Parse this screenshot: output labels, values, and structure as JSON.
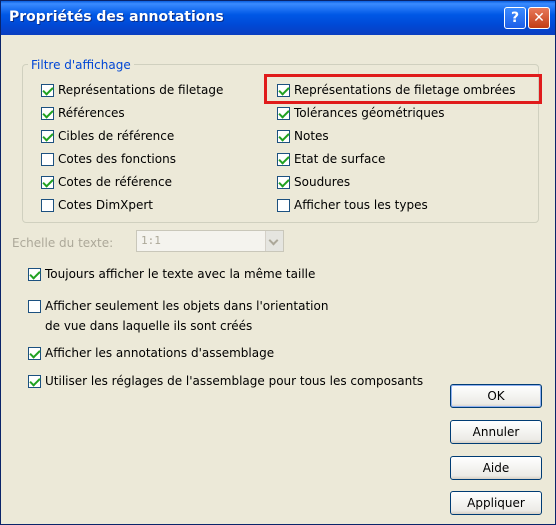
{
  "window": {
    "title": "Propriétés des annotations",
    "help_glyph": "?",
    "close_glyph": "✕"
  },
  "filter": {
    "legend": "Filtre d'affichage",
    "left": [
      {
        "label": "Représentations de filetage",
        "checked": true
      },
      {
        "label": "Références",
        "checked": true
      },
      {
        "label": "Cibles de référence",
        "checked": true
      },
      {
        "label": "Cotes des fonctions",
        "checked": false
      },
      {
        "label": "Cotes de référence",
        "checked": true
      },
      {
        "label": "Cotes DimXpert",
        "checked": false
      }
    ],
    "right": [
      {
        "label": "Représentations de filetage ombrées",
        "checked": true
      },
      {
        "label": "Tolérances géométriques",
        "checked": true
      },
      {
        "label": "Notes",
        "checked": true
      },
      {
        "label": "Etat de surface",
        "checked": true
      },
      {
        "label": "Soudures",
        "checked": true
      },
      {
        "label": "Afficher tous les types",
        "checked": false
      }
    ]
  },
  "scale": {
    "label": "Echelle du texte:",
    "value": "1:1"
  },
  "options": [
    {
      "label": "Toujours afficher le texte avec la même taille",
      "checked": true
    },
    {
      "label": "Afficher seulement les objets dans l'orientation",
      "label2": "de vue dans laquelle ils sont créés",
      "checked": false
    },
    {
      "label": "Afficher les annotations d'assemblage",
      "checked": true
    },
    {
      "label": "Utiliser les réglages de l'assemblage pour tous les composants",
      "checked": true
    }
  ],
  "buttons": {
    "ok": "OK",
    "cancel": "Annuler",
    "help": "Aide",
    "apply": "Appliquer"
  },
  "colors": {
    "title_bar": "#0058e6",
    "legend": "#0046d5",
    "highlight": "#e01b1b",
    "check": "#21a121"
  }
}
